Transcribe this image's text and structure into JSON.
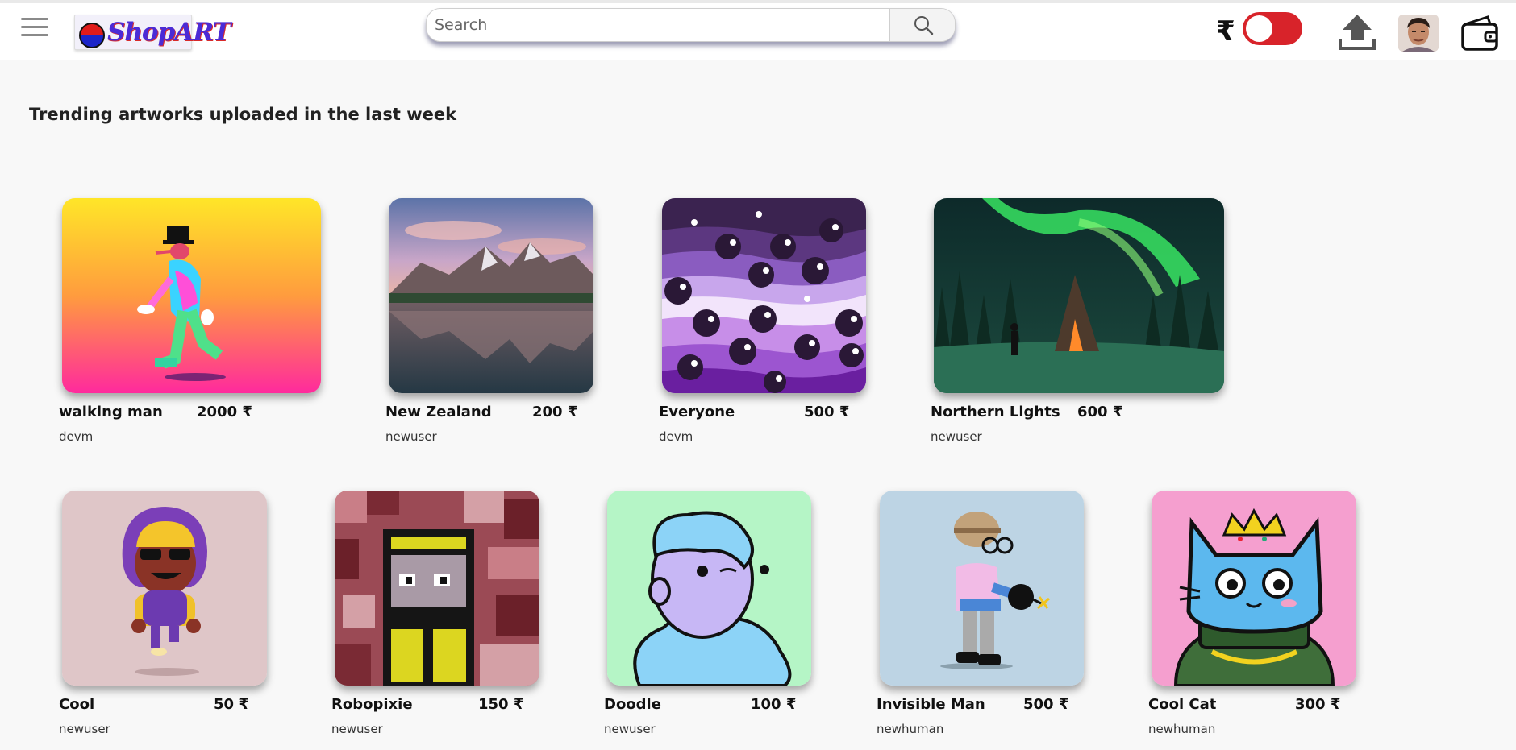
{
  "header": {
    "logo_text": "ShopART",
    "search_placeholder": "Search",
    "search_value": "",
    "currency_symbol": "₹",
    "icons": [
      "menu-icon",
      "search-icon",
      "upload-icon",
      "wallet-icon"
    ],
    "toggle_color": "#d8232a"
  },
  "section": {
    "title": "Trending artworks uploaded in the last week"
  },
  "artworks": [
    {
      "title": "walking man",
      "price": "2000 ₹",
      "user": "devm"
    },
    {
      "title": "New Zealand",
      "price": "200 ₹",
      "user": "newuser"
    },
    {
      "title": "Everyone",
      "price": "500 ₹",
      "user": "devm"
    },
    {
      "title": "Northern Lights",
      "price": "600 ₹",
      "user": "newuser"
    },
    {
      "title": "Cool",
      "price": "50 ₹",
      "user": "newuser"
    },
    {
      "title": "Robopixie",
      "price": "150 ₹",
      "user": "newuser"
    },
    {
      "title": "Doodle",
      "price": "100 ₹",
      "user": "newuser"
    },
    {
      "title": "Invisible Man",
      "price": "500 ₹",
      "user": "newhuman"
    },
    {
      "title": "Cool Cat",
      "price": "300 ₹",
      "user": "newhuman"
    }
  ]
}
